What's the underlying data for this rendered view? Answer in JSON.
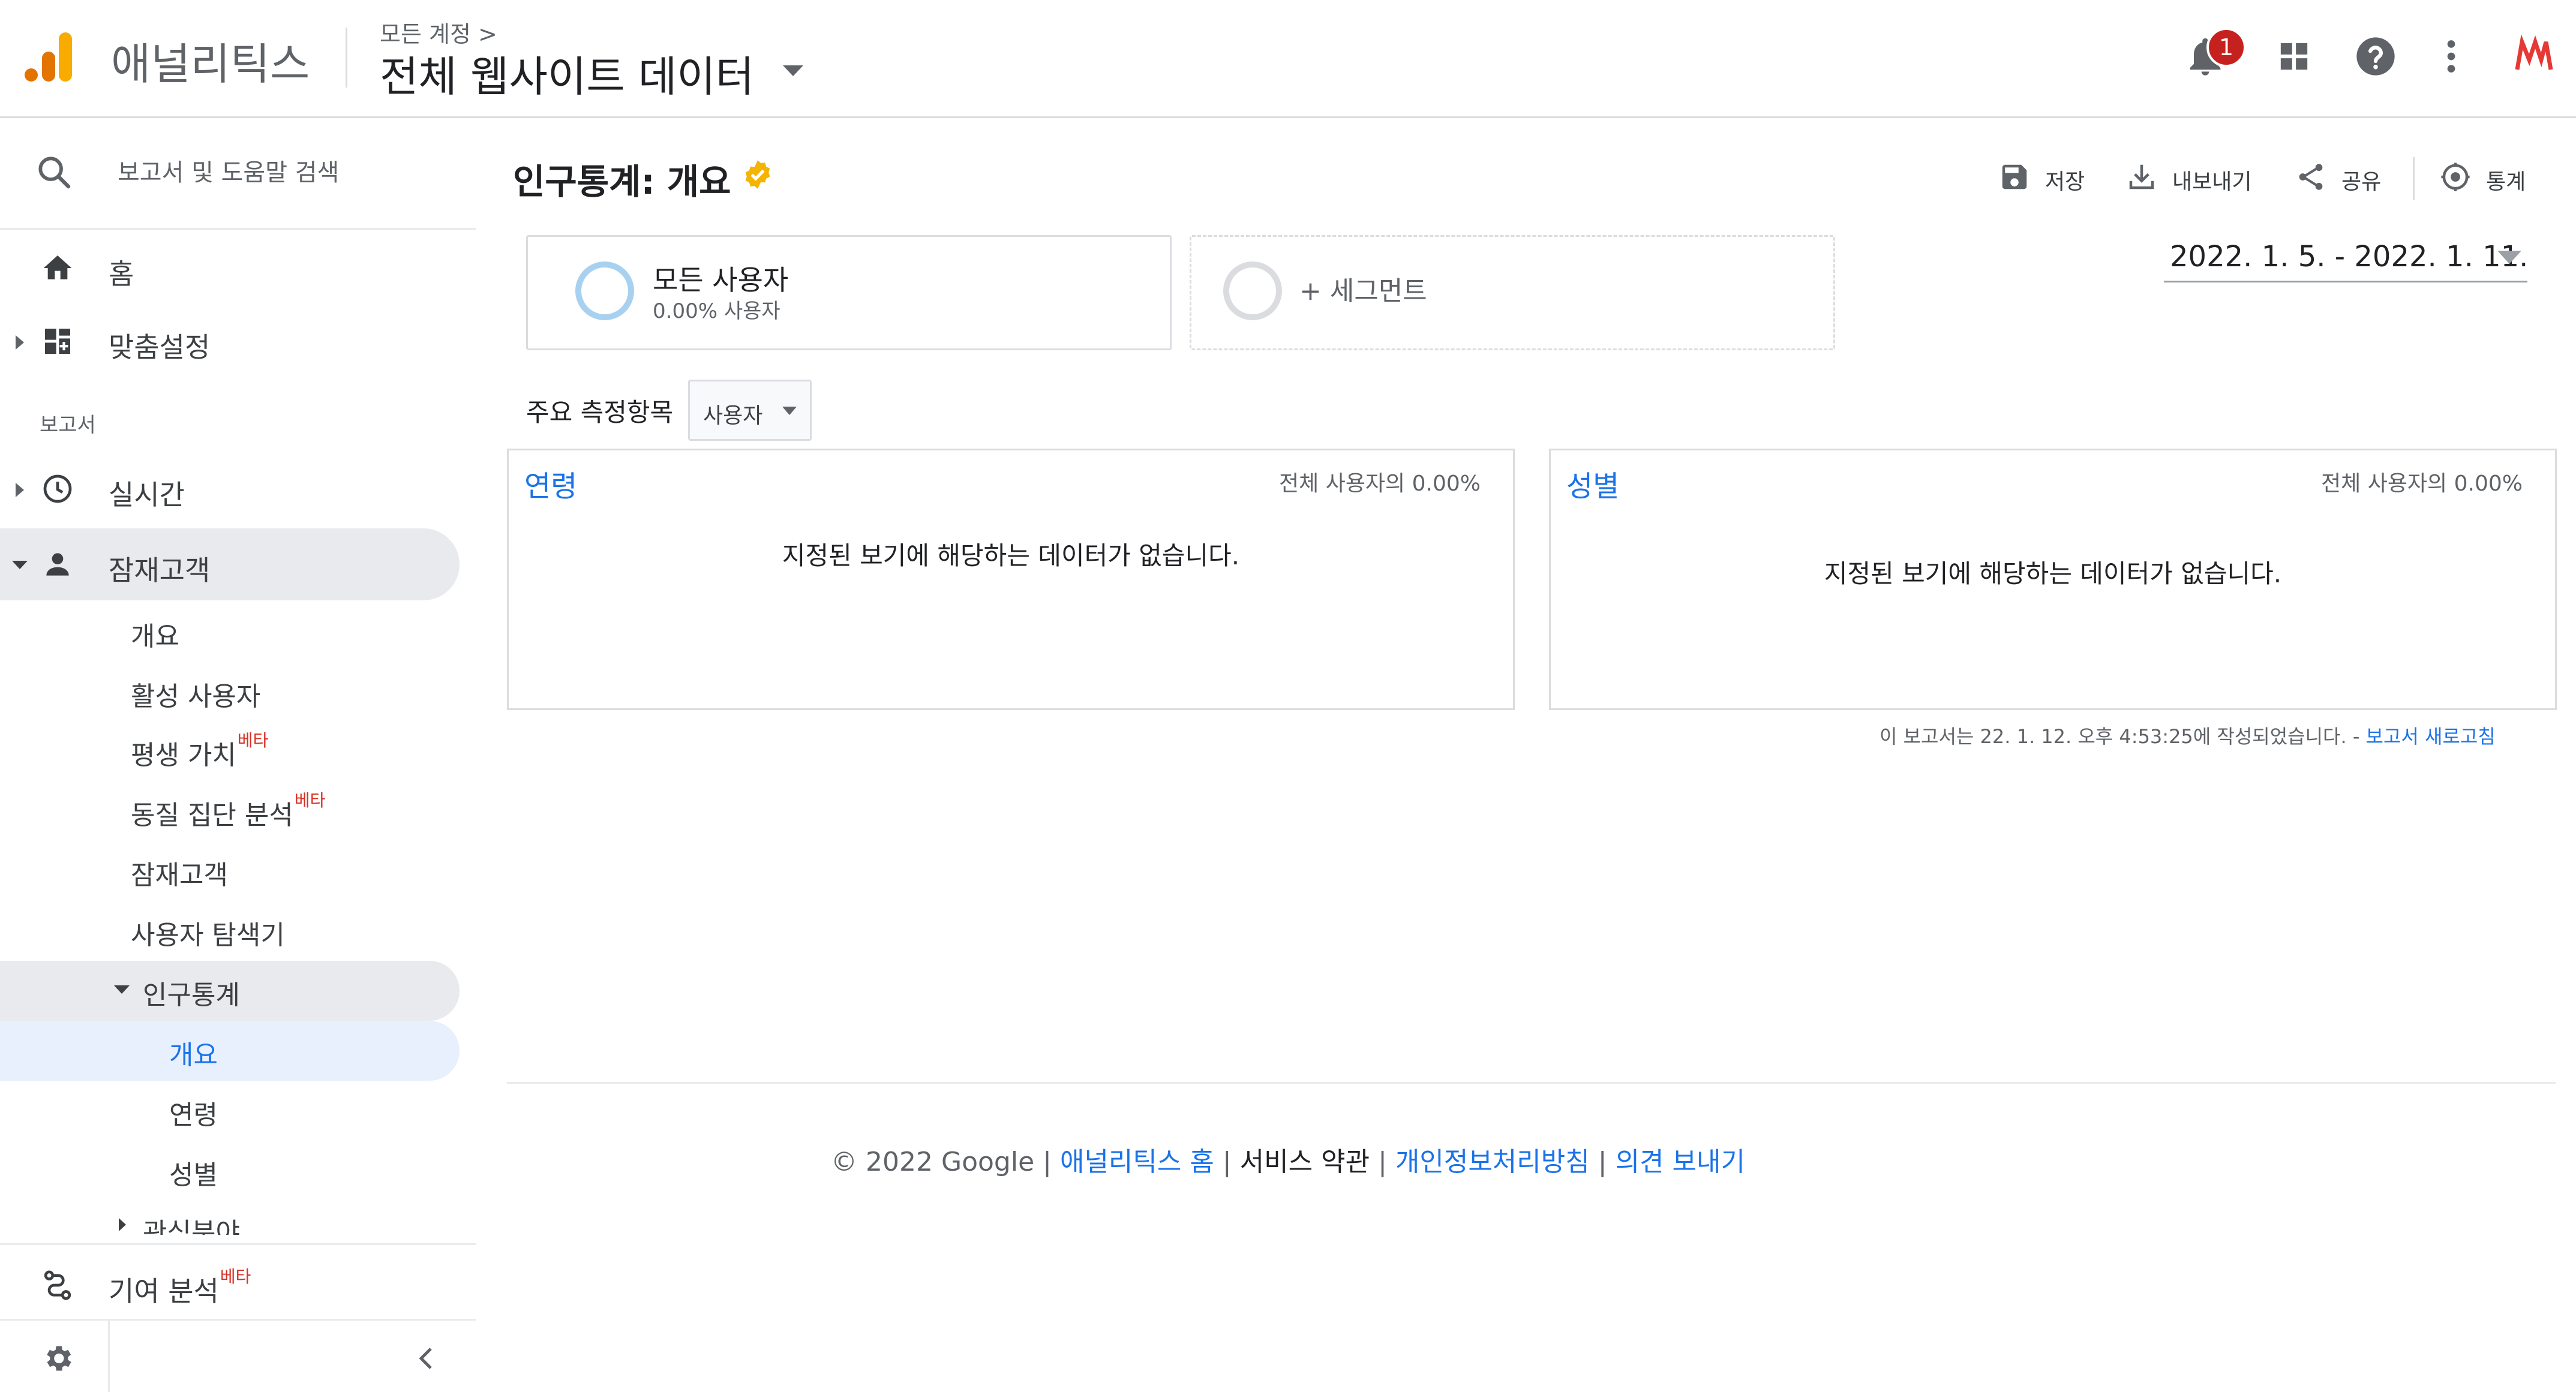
{
  "header": {
    "app_name": "애널리틱스",
    "breadcrumb": "모든 계정 >",
    "view_name": "전체 웹사이트 데이터",
    "notification_count": "1",
    "icons": [
      "notifications-icon",
      "apps-grid-icon",
      "help-icon",
      "more-vert-icon",
      "account-avatar"
    ]
  },
  "sidebar": {
    "search_placeholder": "보고서 및 도움말 검색",
    "home_label": "홈",
    "customization_label": "맞춤설정",
    "section_reports": "보고서",
    "realtime_label": "실시간",
    "audience_label": "잠재고객",
    "audience_items": {
      "overview": "개요",
      "active_users": "활성 사용자",
      "lifetime_value": "평생 가치",
      "cohort_analysis": "동질 집단 분석",
      "audiences": "잠재고객",
      "user_explorer": "사용자 탐색기",
      "demographics": "인구통계"
    },
    "demographics_items": {
      "overview": "개요",
      "age": "연령",
      "gender": "성별"
    },
    "interests_label": "관심분야",
    "attribution_label": "기여 분석",
    "beta_badge": "베타"
  },
  "main": {
    "page_title": "인구통계: 개요",
    "toolbar": {
      "save": "저장",
      "export": "내보내기",
      "share": "공유",
      "insights": "통계"
    },
    "segments": {
      "all_users_name": "모든 사용자",
      "all_users_pct": "0.00% 사용자",
      "add_segment": "+ 세그먼트"
    },
    "date_range": "2022. 1. 5. - 2022. 1. 11.",
    "metric_label": "주요 측정항목",
    "metric_value": "사용자",
    "cards": {
      "age_title": "연령",
      "age_pct": "전체 사용자의 0.00%",
      "age_message": "지정된 보기에 해당하는 데이터가 없습니다.",
      "gender_title": "성별",
      "gender_pct": "전체 사용자의 0.00%",
      "gender_message": "지정된 보기에 해당하는 데이터가 없습니다."
    },
    "report_note": "이 보고서는 22. 1. 12. 오후 4:53:25에 작성되었습니다. -",
    "report_refresh": "보고서 새로고침"
  },
  "footer": {
    "copyright": "© 2022 Google",
    "sep": "|",
    "analytics_home": "애널리틱스 홈",
    "terms": "서비스 약관",
    "privacy": "개인정보처리방침",
    "feedback": "의견 보내기"
  },
  "colors": {
    "accent_blue": "#1a73e8",
    "logo_orange": "#f9ab00",
    "logo_dark_orange": "#e37400",
    "badge_red": "#c5221f",
    "beta_red": "#d93025",
    "verified_gold": "#f4b400",
    "nav_highlight": "#e8eaed",
    "nav_selected": "#e8f0fe"
  }
}
